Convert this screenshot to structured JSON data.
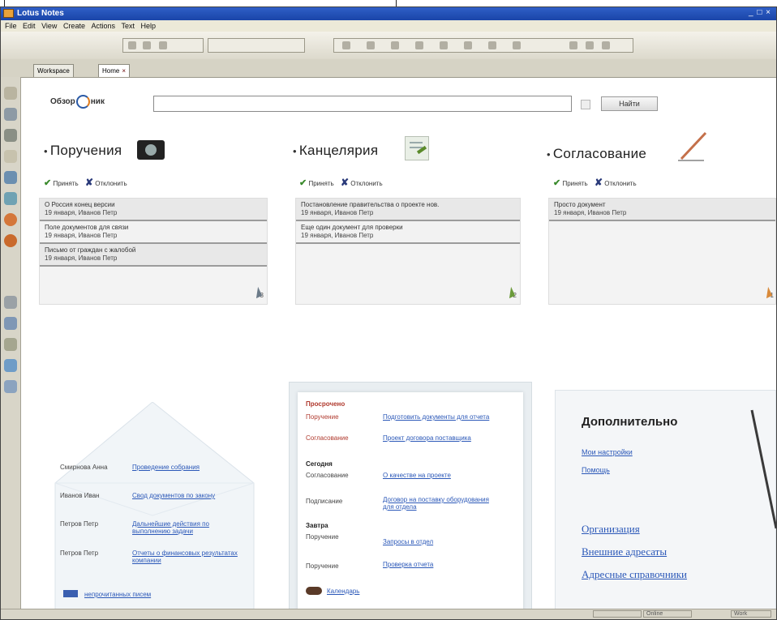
{
  "window": {
    "title": "Lotus Notes",
    "controls": "_ □ ×"
  },
  "menu": [
    "File",
    "Edit",
    "View",
    "Create",
    "Actions",
    "Text",
    "Help"
  ],
  "tabs": [
    {
      "label": "Workspace"
    },
    {
      "label": "Home"
    }
  ],
  "search": {
    "placeholder": "",
    "button_label": "Найти"
  },
  "logo": {
    "left": "Обзор",
    "right": "ник"
  },
  "columns": [
    {
      "title": "Поручения",
      "accept": "Принять",
      "reject": "Отклонить",
      "items": [
        {
          "text": "О Россия конец версии",
          "meta": "19 января, Иванов Петр"
        },
        {
          "text": "Поле документов для связи",
          "meta": "19 января, Иванов Петр"
        },
        {
          "text": "Письмо от граждан с жалобой",
          "meta": "19 января, Иванов Петр"
        }
      ],
      "count": "3"
    },
    {
      "title": "Канцелярия",
      "accept": "Принять",
      "reject": "Отклонить",
      "items": [
        {
          "text": "Постановление правительства о проекте нов.",
          "meta": "19 января, Иванов Петр"
        },
        {
          "text": "Еще один документ для проверки",
          "meta": "19 января, Иванов Петр"
        }
      ],
      "count": "2"
    },
    {
      "title": "Согласование",
      "accept": "Принять",
      "reject": "Отклонить",
      "items": [
        {
          "text": "Просто документ",
          "meta": "19 января, Иванов Петр"
        }
      ],
      "count": "1"
    }
  ],
  "left_card": {
    "rows": [
      {
        "name": "Смирнова Анна",
        "link": "Проведение собрания"
      },
      {
        "name": "Иванов Иван",
        "link": "Свод документов по закону"
      },
      {
        "name": "Петров Петр",
        "link": "Дальнейшие действия по выполнению задачи"
      },
      {
        "name": "Петров Петр",
        "link": "Отчеты о финансовых результатах компании"
      }
    ],
    "footer": "непрочитанных писем"
  },
  "mid_card": {
    "overdue_title": "Просрочено",
    "overdue": [
      {
        "name": "Поручение",
        "link": "Подготовить документы для отчета"
      },
      {
        "name": "Согласование",
        "link": "Проект договора поставщика"
      }
    ],
    "today_title": "Сегодня",
    "today": [
      {
        "name": "Согласование",
        "link": "О качестве на проекте"
      },
      {
        "name": "Подписание",
        "link": "Договор на поставку оборудования для отдела"
      }
    ],
    "tomorrow_title": "Завтра",
    "tomorrow": [
      {
        "name": "Поручение",
        "link": "Запросы в отдел"
      },
      {
        "name": "Поручение",
        "link": "Проверка отчета"
      }
    ],
    "footer": "Календарь"
  },
  "right_card": {
    "title": "Дополнительно",
    "links_small": [
      "Мои настройки",
      "Помощь"
    ],
    "links_large": [
      "Организация",
      "Внешние адресаты",
      "Адресные справочники"
    ]
  },
  "status": {
    "seg1": "",
    "seg2": "Online",
    "seg3": "Work"
  },
  "colors": {
    "titlebar": "#1f4fb7",
    "link": "#2b58b8",
    "overdue": "#b03a2e",
    "accept": "#3a8a2c"
  }
}
